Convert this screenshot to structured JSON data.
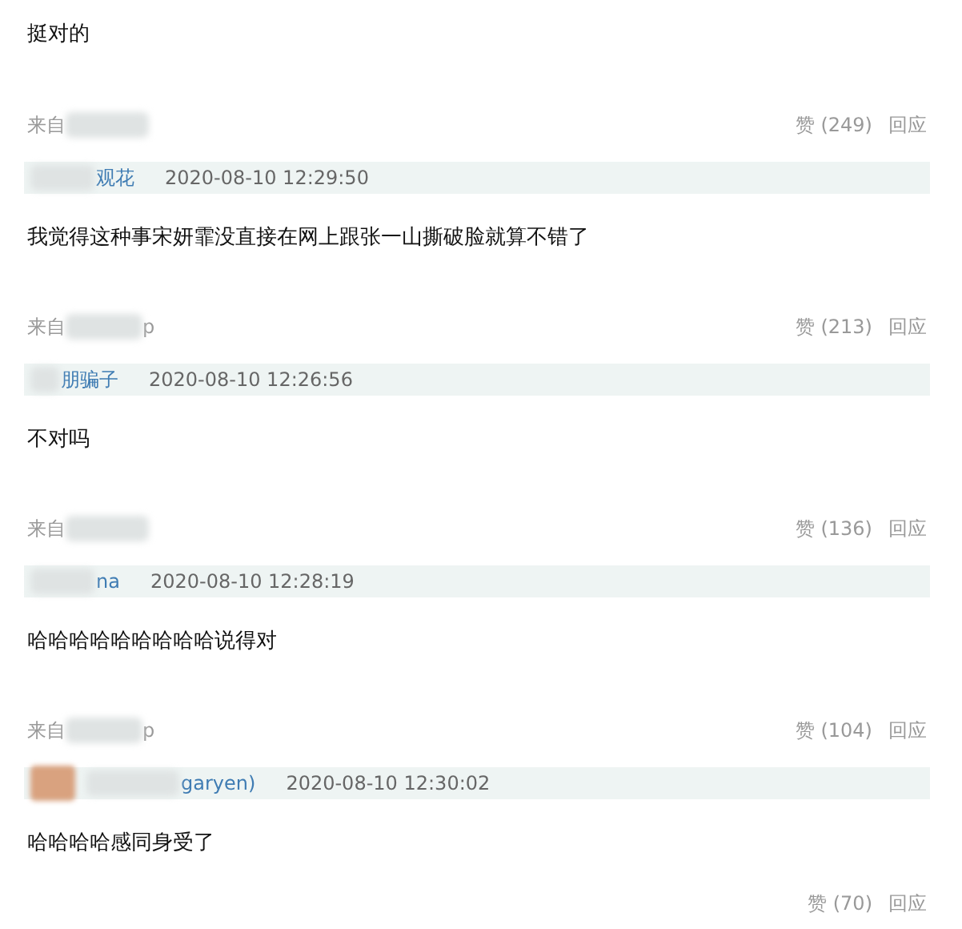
{
  "first_text": "挺对的",
  "comments": [
    {
      "source_label": "来自",
      "likes": "赞 (249)",
      "reply": "回应",
      "avatar": false,
      "user": "观花",
      "time": "2020-08-10 12:29:50",
      "text": "我觉得这种事宋妍霏没直接在网上跟张一山撕破脸就算不错了"
    },
    {
      "source_label": "来自",
      "source_tail": "p",
      "likes": "赞 (213)",
      "reply": "回应",
      "avatar": false,
      "user": "朋骗子",
      "time": "2020-08-10 12:26:56",
      "text": "不对吗"
    },
    {
      "source_label": "来自",
      "likes": "赞 (136)",
      "reply": "回应",
      "avatar": false,
      "user": "na",
      "time": "2020-08-10 12:28:19",
      "text": "哈哈哈哈哈哈哈哈哈说得对"
    },
    {
      "source_label": "来自",
      "source_tail": "p",
      "likes": "赞 (104)",
      "reply": "回应",
      "avatar": true,
      "user": "garyen)",
      "time": "2020-08-10 12:30:02",
      "text": "哈哈哈哈感同身受了"
    }
  ],
  "last_meta": {
    "likes": "赞 (70)",
    "reply": "回应"
  }
}
